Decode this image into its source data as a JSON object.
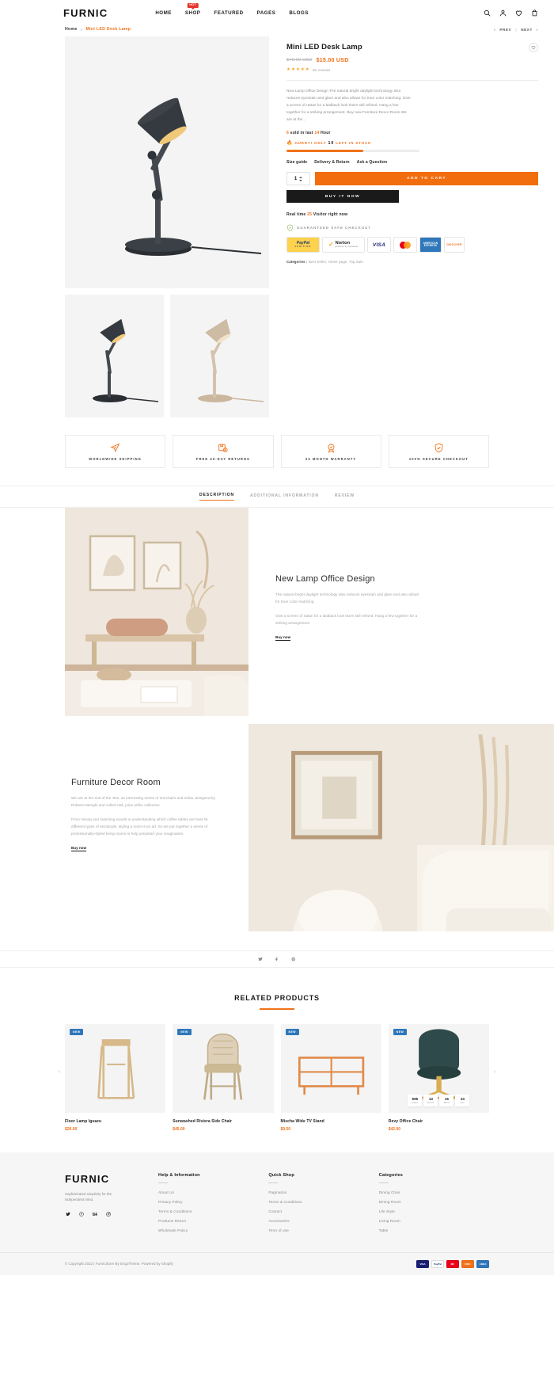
{
  "header": {
    "brand": "FURNIC",
    "nav": [
      {
        "label": "HOME",
        "badge": ""
      },
      {
        "label": "SHOP",
        "badge": "HOT"
      },
      {
        "label": "FEATURED",
        "badge": ""
      },
      {
        "label": "PAGES",
        "badge": ""
      },
      {
        "label": "BLOGS",
        "badge": ""
      }
    ],
    "icons": [
      "search-icon",
      "account-icon",
      "wishlist-icon",
      "cart-icon"
    ]
  },
  "breadcrumb": {
    "home": "Home",
    "separator": ">",
    "current": "Mini LED Desk Lamp",
    "prev": "PREV",
    "next": "NEXT",
    "prev_arrow": "‹",
    "next_arrow": "›",
    "divider": "|"
  },
  "product": {
    "title": "Mini LED Desk Lamp",
    "price_old": "$70.00 USD",
    "price_new": "$15.00 USD",
    "rating_stars": 5,
    "rating_text": "No reviews",
    "description": "New Lamp Office Design The natural bright daylight technology also reduces eyestrain and glare and also allows for truer color matching. Give a screen of rattan for a laidback look that's still refined. Hang a few together for a striking arrangement. Buy now Furniture Decor Room We are at the...",
    "sold_prefix": "6",
    "sold_mid": "sold in last",
    "sold_hours": "14",
    "sold_suffix": "Hour",
    "hurry_prefix": "HURRY! ONLY",
    "hurry_count": "10",
    "hurry_suffix": "LEFT IN STOCK",
    "stock_percent": 58,
    "meta_links": [
      "Size guide",
      "Delivery & Return",
      "Ask a Question"
    ],
    "quantity": "1",
    "add_to_cart": "ADD TO CART",
    "buy_now": "BUY IT NOW",
    "realtime_prefix": "Real time",
    "realtime_count": "25",
    "realtime_suffix": "Visitor right now",
    "safe_checkout": "GUARANTEED SAFE CHECKOUT",
    "payments": [
      {
        "name": "paypal",
        "line1": "PayPal",
        "line2": "VERIFIED"
      },
      {
        "name": "norton",
        "line1": "Norton",
        "line2": "powered by Symantec"
      },
      {
        "name": "visa",
        "label": "VISA"
      },
      {
        "name": "mastercard",
        "label": ""
      },
      {
        "name": "amex",
        "label": "AMERICAN EXPRESS"
      },
      {
        "name": "discover",
        "label": "DISCOVER"
      }
    ],
    "categories_label": "Categories :",
    "categories_value": "Best Seller, Home page, Top Sale"
  },
  "features": [
    {
      "icon": "plane-icon",
      "label": "WORLDWIDE SHIPPING"
    },
    {
      "icon": "return-box-icon",
      "label": "FREE 40-DAY RETURNS"
    },
    {
      "icon": "warranty-badge-icon",
      "label": "24 MONTH WARRANTY"
    },
    {
      "icon": "shield-icon",
      "label": "100% SECURE CHECKOUT"
    }
  ],
  "tabs": [
    {
      "label": "DESCRIPTION",
      "active": true
    },
    {
      "label": "ADDITIONAL INFORMATION",
      "active": false
    },
    {
      "label": "REVIEW",
      "active": false
    }
  ],
  "editorial": [
    {
      "title": "New Lamp Office Design",
      "paragraphs": [
        "The natural bright daylight technology also reduces eyestrain and glare and also allows for truer color matching.",
        "Give a screen of rattan for a laidback look that's still refined. Hang a few together for a striking arrangement."
      ],
      "link": "Buy now"
    },
    {
      "title": "Furniture Decor Room",
      "paragraphs": [
        "We are at the end of the '50s, an interesting series of armchairs and sofas, designed by Roberto Menghi and called Hall, joins arflex collection.",
        "From mixing and matching woods to understanding which coffee tables are best for different types of sectionals, styling a room is an art. So we put together a series of professionally-styled living rooms to help jumpstart your imagination."
      ],
      "link": "Buy now"
    }
  ],
  "share": {
    "icons": [
      "twitter-icon",
      "facebook-icon",
      "pinterest-icon"
    ]
  },
  "related": {
    "heading": "RELATED PRODUCTS",
    "badge_label": "NEW",
    "prev_arrow": "‹",
    "next_arrow": "›",
    "products": [
      {
        "name": "Floor Lamp Iguazu",
        "price": "$26.00",
        "badge": "NEW",
        "countdown": null
      },
      {
        "name": "Sunwashed Riviera Side Chair",
        "price": "$45.00",
        "badge": "NEW",
        "countdown": null
      },
      {
        "name": "Mischa Wide TV Stand",
        "price": "$9.50",
        "badge": "NEW",
        "countdown": null
      },
      {
        "name": "Revy Office Chair",
        "price": "$42.00",
        "badge": "NEW",
        "countdown": [
          {
            "num": "595",
            "label": "Days"
          },
          {
            "num": "13",
            "label": "Hours"
          },
          {
            "num": "15",
            "label": "Mins"
          },
          {
            "num": "33",
            "label": "Sec"
          }
        ]
      }
    ]
  },
  "footer": {
    "brand": "FURNIC",
    "tagline": "Sophisticated simplicity for the independent mind.",
    "social": [
      "twitter-icon",
      "pinterest-icon",
      "behance-icon",
      "instagram-icon"
    ],
    "columns": [
      {
        "title": "Help & Information",
        "links": [
          "About Us",
          "Privacy Policy",
          "Terms & Conditions",
          "Products Return",
          "Wholesale Policy"
        ]
      },
      {
        "title": "Quick Shop",
        "links": [
          "Pagination",
          "Terms & Conditions",
          "Contact",
          "Accessories",
          "Term of use"
        ]
      },
      {
        "title": "Categories",
        "links": [
          "Dining Chair",
          "Dining Room",
          "Life Style",
          "Living Room",
          "Table"
        ]
      }
    ],
    "copyright": "© Copyright 2022 | FurnicStore By EngoTheme. Powered by Shopify",
    "payment_icons": [
      "visa",
      "paypal",
      "mastercard",
      "discover",
      "amex"
    ]
  },
  "colors": {
    "accent": "#f0721a",
    "cart_button": "#f26d0d",
    "dark": "#1a1a1a",
    "badge_blue": "#2e77bb",
    "hot_red": "#e8342a"
  }
}
